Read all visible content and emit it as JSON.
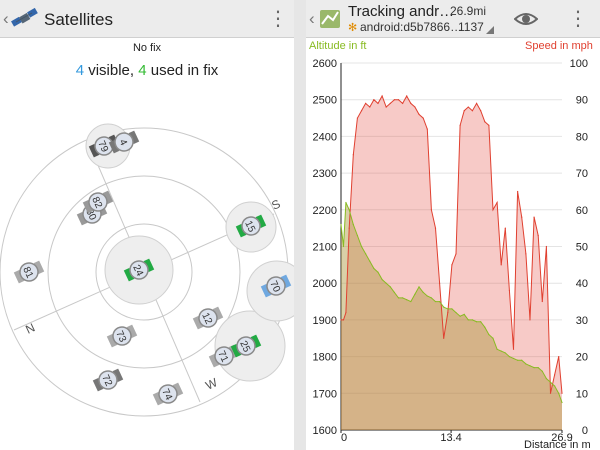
{
  "left": {
    "title": "Satellites",
    "fix_text": "No fix",
    "visible_count": "4",
    "visible_label": " visible, ",
    "used_count": "4",
    "used_label": " used in fix",
    "compass": {
      "north": "N",
      "south": "S",
      "west": "W"
    },
    "satellites": [
      {
        "id": "79",
        "used": false
      },
      {
        "id": "4",
        "used": false
      },
      {
        "id": "80",
        "used": false
      },
      {
        "id": "82",
        "used": false
      },
      {
        "id": "15",
        "used": true
      },
      {
        "id": "81",
        "used": false
      },
      {
        "id": "24",
        "used": true
      },
      {
        "id": "70",
        "used": false
      },
      {
        "id": "12",
        "used": false
      },
      {
        "id": "73",
        "used": false
      },
      {
        "id": "71",
        "used": false
      },
      {
        "id": "25",
        "used": true
      },
      {
        "id": "72",
        "used": false
      },
      {
        "id": "74",
        "used": false
      }
    ],
    "colors": {
      "used": "#22aa44",
      "unused": "#8a8a8a",
      "sbas": "#6fa8e0"
    }
  },
  "right": {
    "title": "Tracking andr…",
    "subtitle": "android:d5b7866…",
    "distance": "26.9mi",
    "count": "1137",
    "altitude_label": "Altitude in ft",
    "speed_label": "Speed in mph",
    "distance_label": "Distance in m",
    "colors": {
      "altitude": "#88bb22",
      "speed": "#e04030"
    }
  },
  "chart_data": {
    "type": "area",
    "xlabel": "Distance in m",
    "x_ticks": [
      "0",
      "13.4",
      "26.9"
    ],
    "xlim": [
      0,
      26.9
    ],
    "y_left": {
      "label": "Altitude in ft",
      "ylim": [
        1600,
        2600
      ],
      "ticks": [
        "1600",
        "1700",
        "1800",
        "1900",
        "2000",
        "2100",
        "2200",
        "2300",
        "2400",
        "2500",
        "2600"
      ]
    },
    "y_right": {
      "label": "Speed in mph",
      "ylim": [
        0,
        100
      ],
      "ticks": [
        "0",
        "10",
        "20",
        "30",
        "40",
        "50",
        "60",
        "70",
        "80",
        "90",
        "100"
      ]
    },
    "grid": true,
    "series": [
      {
        "name": "Altitude in ft",
        "axis": "left",
        "x": [
          0,
          0.3,
          0.6,
          1,
          1.5,
          2,
          2.5,
          3,
          3.5,
          4,
          4.5,
          5,
          5.5,
          6,
          6.5,
          7,
          7.5,
          8,
          8.5,
          9,
          9.5,
          10,
          10.5,
          11,
          11.5,
          12,
          12.5,
          13,
          13.5,
          14,
          14.5,
          15,
          15.5,
          16,
          16.5,
          17,
          17.5,
          18,
          18.5,
          19,
          19.5,
          20,
          20.5,
          21,
          21.5,
          22,
          22.5,
          23,
          23.5,
          24,
          24.5,
          25,
          25.5,
          26,
          26.5,
          26.9
        ],
        "values": [
          2160,
          2100,
          2220,
          2200,
          2160,
          2130,
          2100,
          2080,
          2060,
          2040,
          2030,
          2010,
          2000,
          1990,
          1975,
          1960,
          1960,
          1955,
          1950,
          1970,
          1990,
          1975,
          1965,
          1960,
          1950,
          1950,
          1935,
          1930,
          1930,
          1920,
          1910,
          1915,
          1900,
          1900,
          1895,
          1895,
          1880,
          1860,
          1850,
          1820,
          1815,
          1810,
          1800,
          1795,
          1790,
          1790,
          1780,
          1775,
          1770,
          1770,
          1760,
          1740,
          1730,
          1720,
          1700,
          1675
        ]
      },
      {
        "name": "Speed in mph",
        "axis": "right",
        "x": [
          0,
          0.3,
          0.6,
          1,
          1.5,
          2,
          2.5,
          3,
          3.5,
          4,
          4.5,
          5,
          5.5,
          6,
          6.5,
          7,
          7.5,
          8,
          8.5,
          9,
          9.5,
          10,
          10.5,
          11,
          11.5,
          12,
          12.5,
          13,
          13.5,
          14,
          14.5,
          15,
          15.5,
          16,
          16.5,
          17,
          17.5,
          18,
          18.5,
          19,
          19.5,
          20,
          20.5,
          21,
          21.5,
          22,
          22.5,
          23,
          23.5,
          24,
          24.5,
          25,
          25.5,
          26,
          26.5,
          26.9
        ],
        "values": [
          30,
          30,
          32,
          55,
          75,
          85,
          87,
          89,
          88,
          90,
          89,
          91,
          88,
          89,
          90,
          90,
          89,
          91,
          89,
          88,
          86,
          85,
          82,
          60,
          55,
          40,
          25,
          32,
          45,
          48,
          83,
          87,
          88,
          87,
          89,
          87,
          84,
          83,
          60,
          62,
          45,
          55,
          38,
          22,
          65,
          58,
          48,
          30,
          58,
          53,
          35,
          50,
          10,
          15,
          20,
          10
        ]
      }
    ]
  }
}
